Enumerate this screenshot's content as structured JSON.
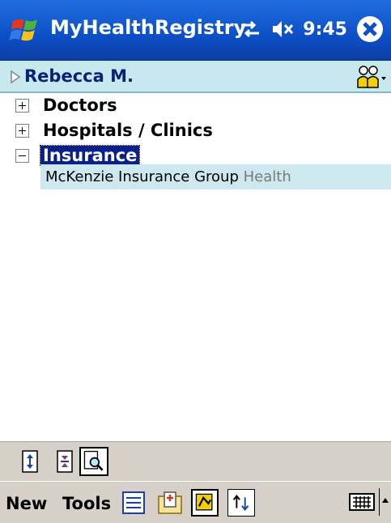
{
  "titlebar": {
    "app_title": "MyHealthRegistry",
    "time": "9:45",
    "icons": [
      "windows-start-icon",
      "connectivity-icon",
      "speaker-muted-icon",
      "close-icon"
    ]
  },
  "person": {
    "name": "Rebecca M."
  },
  "tree": {
    "nodes": [
      {
        "label": "Doctors",
        "expanded": false
      },
      {
        "label": "Hospitals / Clinics",
        "expanded": false
      },
      {
        "label": "Insurance",
        "expanded": true,
        "selected": true
      }
    ],
    "insurance_child": {
      "name": "McKenzie Insurance Group",
      "type": "Health"
    }
  },
  "toolbar": {
    "icons": [
      "expand-all-icon",
      "collapse-all-icon",
      "find-icon"
    ]
  },
  "menubar": {
    "new_label": "New",
    "tools_label": "Tools",
    "icons": [
      "list-view-icon",
      "contact-card-icon",
      "insurance-view-icon",
      "sort-icon",
      "keyboard-icon"
    ]
  },
  "colors": {
    "title_bar": "#0d4fc6",
    "person_bar": "#c8e8f0",
    "selection": "#0a1f8a",
    "child_highlight": "#cde8ee",
    "toolbar_bg": "#d6d0c8"
  }
}
